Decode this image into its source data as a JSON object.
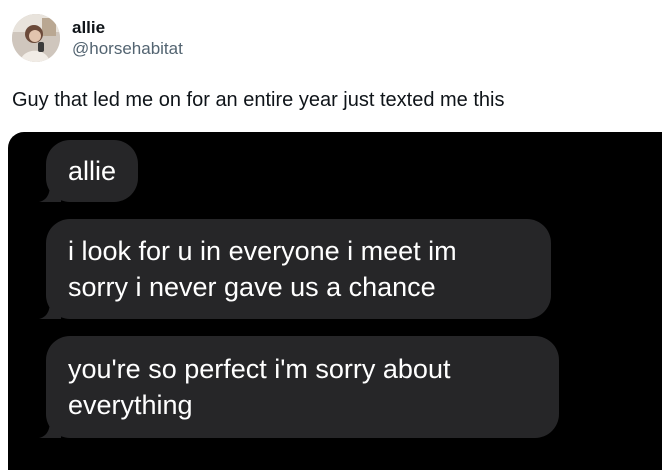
{
  "tweet": {
    "display_name": "allie",
    "handle": "@horsehabitat",
    "avatar_icon": "profile-photo-avatar",
    "text": "Guy that led me on for an entire year just texted me this"
  },
  "screenshot": {
    "background": "#000000",
    "bubble_color": "#262628",
    "messages": [
      {
        "lines": [
          "allie"
        ]
      },
      {
        "lines": [
          "i look for u in everyone i meet im",
          "sorry i never gave us a chance"
        ]
      },
      {
        "lines": [
          "you're so perfect i'm sorry about",
          "everything"
        ]
      }
    ]
  },
  "colors": {
    "text_primary": "#0f1419",
    "text_secondary": "#536471"
  }
}
